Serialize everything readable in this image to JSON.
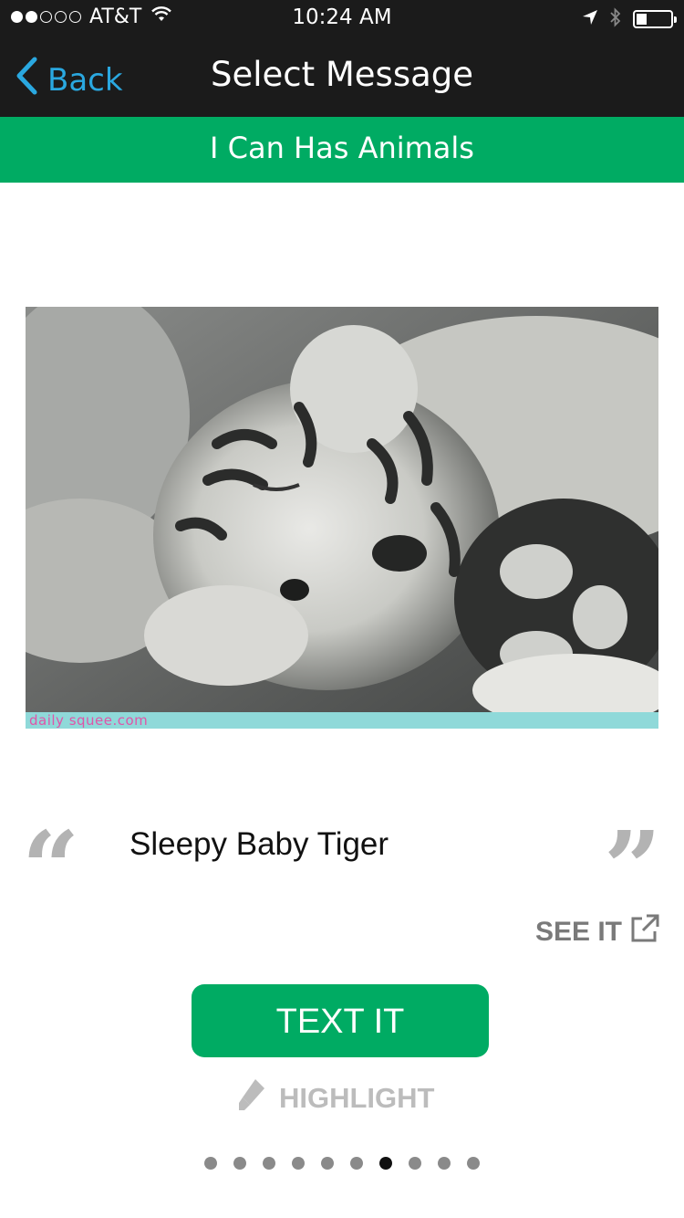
{
  "status_bar": {
    "carrier": "AT&T",
    "time": "10:24 AM",
    "signal_bars_filled": 2,
    "signal_bars_total": 5,
    "battery_level": 0.3
  },
  "nav": {
    "back_label": "Back",
    "title": "Select Message"
  },
  "category": {
    "title": "I Can Has Animals"
  },
  "message": {
    "image_watermark": "daily squee.com",
    "open_quote": "“",
    "close_quote": "”",
    "caption": "Sleepy Baby Tiger"
  },
  "actions": {
    "see_it_label": "SEE IT",
    "text_it_label": "TEXT IT",
    "highlight_label": "HIGHLIGHT"
  },
  "pagination": {
    "total": 10,
    "active_index": 6
  },
  "colors": {
    "accent_green": "#00ab63",
    "link_blue": "#2aa8e0",
    "bar_dark": "#1b1b1b"
  }
}
